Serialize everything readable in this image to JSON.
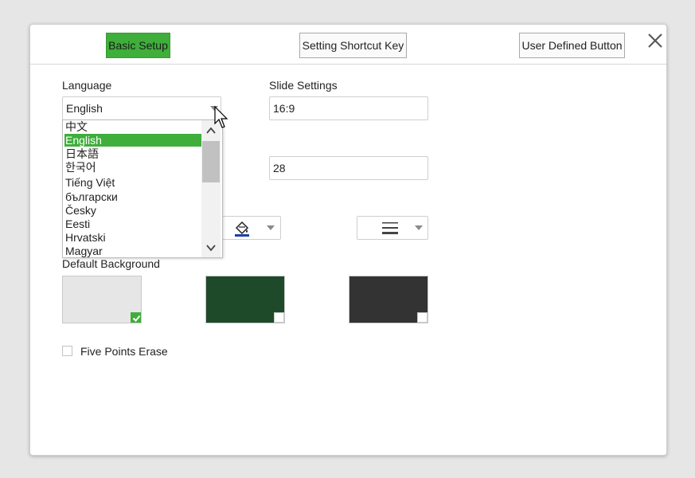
{
  "tabs": [
    {
      "label": "Basic Setup",
      "active": true
    },
    {
      "label": "Setting Shortcut Key",
      "active": false
    },
    {
      "label": "User Defined Button",
      "active": false
    }
  ],
  "language": {
    "label": "Language",
    "value": "English",
    "options": [
      "中文",
      "English",
      "日本語",
      "한국어",
      "Tiếng Việt",
      "български",
      "Česky",
      "Eesti",
      "Hrvatski",
      "Magyar"
    ],
    "selected": "English"
  },
  "slide_settings": {
    "label": "Slide Settings",
    "value": "16:9"
  },
  "font_size": {
    "value": "28"
  },
  "pen_color_icon": "paint-bucket-icon",
  "line_style_icon": "line-weight-icon",
  "default_background": {
    "label": "Default Background",
    "swatches": [
      {
        "color": "#e6e6e6",
        "checked": true
      },
      {
        "color": "#1f4a29",
        "checked": false
      },
      {
        "color": "#333333",
        "checked": false
      }
    ]
  },
  "five_points_erase": {
    "label": "Five Points Erase",
    "checked": false
  },
  "colors": {
    "accent": "#3fae3b",
    "pen_underline": "#1f3fa8"
  }
}
